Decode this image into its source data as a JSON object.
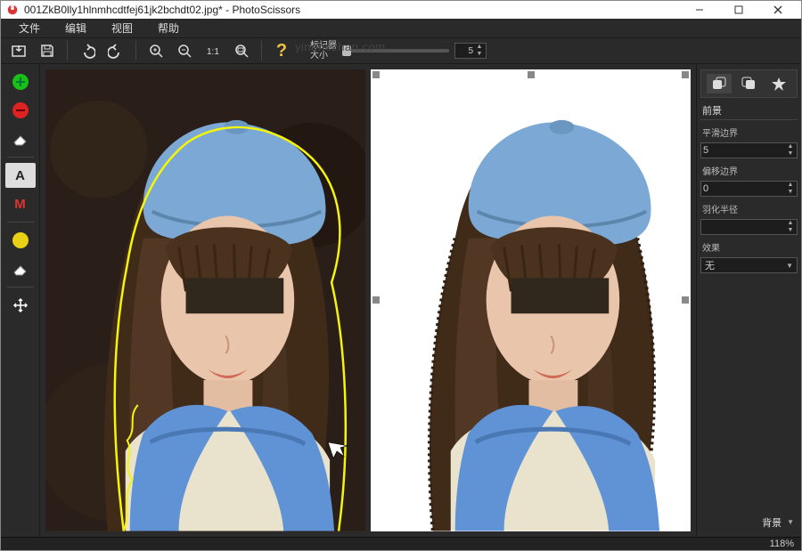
{
  "window": {
    "title": "001ZkB0lly1hlnmhcdtfej61jk2bchdt02.jpg* - PhotoScissors"
  },
  "menu": {
    "file": "文件",
    "edit": "编辑",
    "view": "视图",
    "help": "帮助"
  },
  "toolbar": {
    "marker_label_1": "标记器",
    "marker_label_2": "大小",
    "marker_value": "5",
    "watermark": "yinghezhan.com"
  },
  "tools": {
    "auto_label": "A",
    "manual_label": "M"
  },
  "props": {
    "section": "前景",
    "smooth_label": "平滑边界",
    "smooth_value": "5",
    "offset_label": "偏移边界",
    "offset_value": "0",
    "feather_label": "羽化半径",
    "feather_value": "",
    "effect_label": "效果",
    "effect_value": "无",
    "background_label": "背景"
  },
  "status": {
    "zoom": "118%"
  }
}
